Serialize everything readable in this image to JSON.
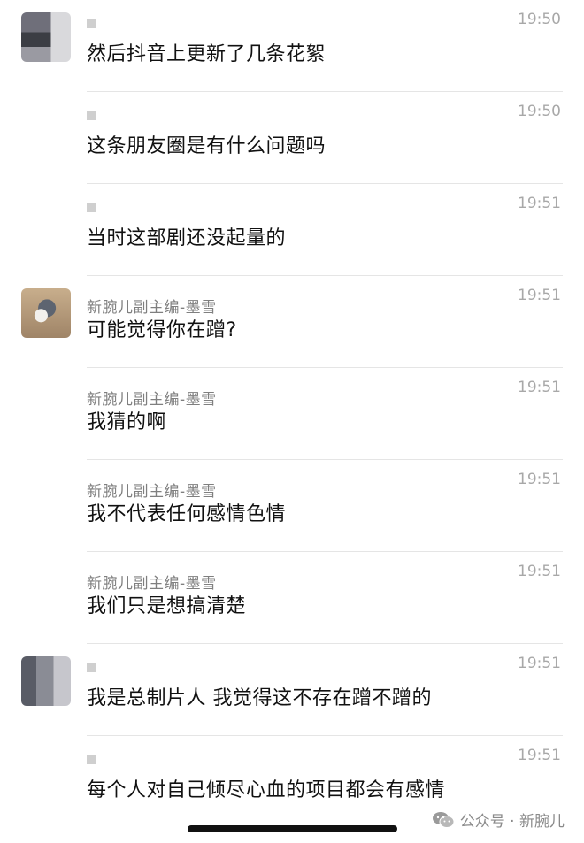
{
  "messages": [
    {
      "sender": "",
      "time": "19:50",
      "text": "然后抖音上更新了几条花絮",
      "avatar": "blurred-avatar"
    },
    {
      "sender": "",
      "time": "19:50",
      "text": "这条朋友圈是有什么问题吗",
      "avatar": ""
    },
    {
      "sender": "",
      "time": "19:51",
      "text": "当时这部剧还没起量的",
      "avatar": ""
    },
    {
      "sender": "新腕儿副主编-墨雪",
      "time": "19:51",
      "text": "可能觉得你在蹭?",
      "avatar": "cat-avatar"
    },
    {
      "sender": "新腕儿副主编-墨雪",
      "time": "19:51",
      "text": "我猜的啊",
      "avatar": ""
    },
    {
      "sender": "新腕儿副主编-墨雪",
      "time": "19:51",
      "text": "我不代表任何感情色情",
      "avatar": ""
    },
    {
      "sender": "新腕儿副主编-墨雪",
      "time": "19:51",
      "text": "我们只是想搞清楚",
      "avatar": ""
    },
    {
      "sender": "",
      "time": "19:51",
      "text": "我是总制片人 我觉得这不存在蹭不蹭的",
      "avatar": "blurred-avatar"
    },
    {
      "sender": "",
      "time": "19:51",
      "text": "每个人对自己倾尽心血的项目都会有感情",
      "avatar": ""
    }
  ],
  "watermark": {
    "icon": "wechat-icon",
    "text": "公众号 · 新腕儿"
  }
}
